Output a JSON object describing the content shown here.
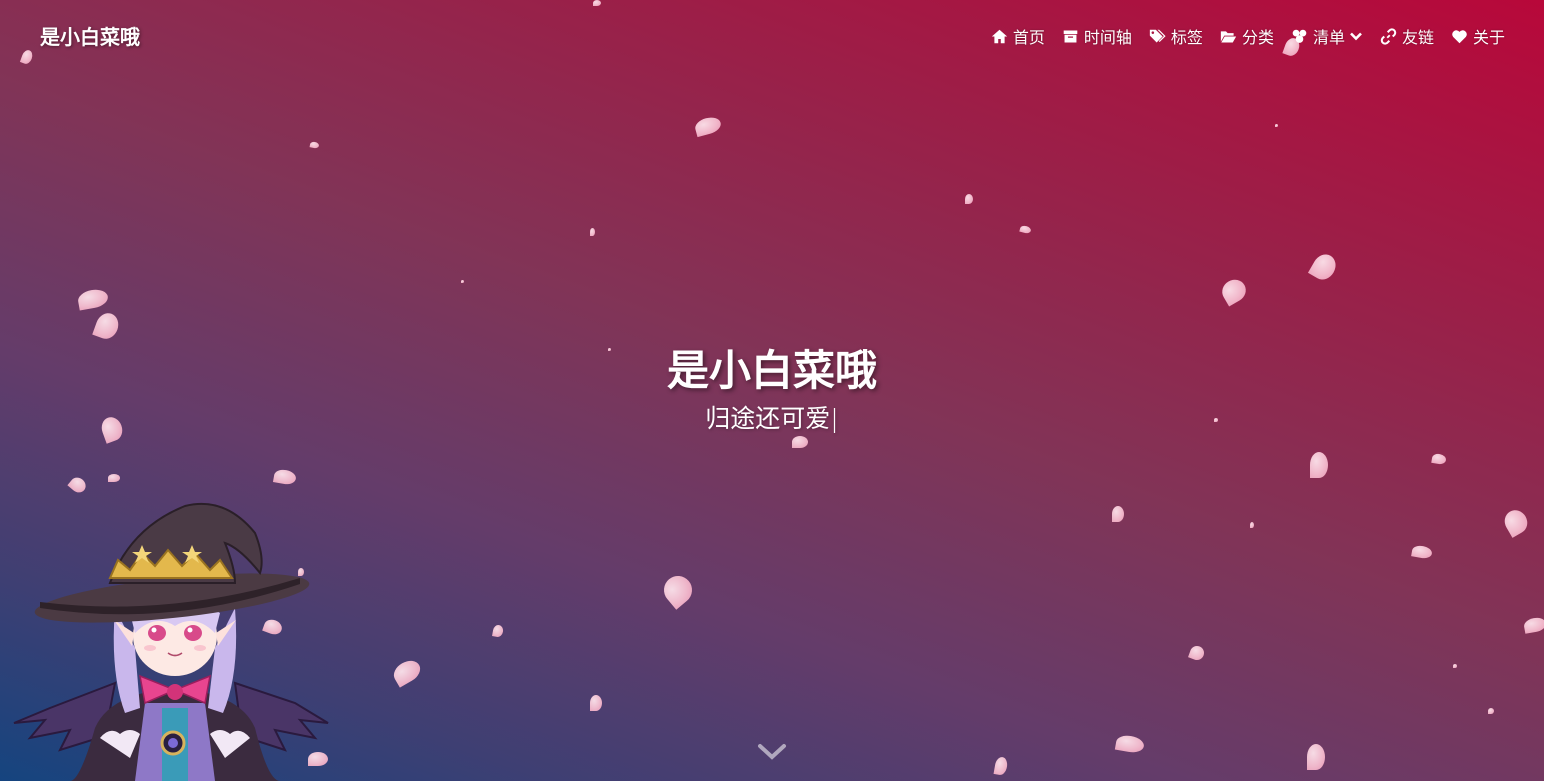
{
  "header": {
    "brand": "是小白菜哦",
    "nav": [
      {
        "label": "首页",
        "icon": "home-icon"
      },
      {
        "label": "时间轴",
        "icon": "archive-icon"
      },
      {
        "label": "标签",
        "icon": "tags-icon"
      },
      {
        "label": "分类",
        "icon": "folder-open-icon"
      },
      {
        "label": "清单",
        "icon": "list-icon",
        "dropdown": true
      },
      {
        "label": "友链",
        "icon": "link-icon"
      },
      {
        "label": "关于",
        "icon": "heart-icon"
      }
    ]
  },
  "hero": {
    "title": "是小白菜哦",
    "subtitle": "归途还可爱",
    "cursor": "|"
  },
  "colors": {
    "gradient_top_right": "#b8083a",
    "gradient_bottom_left": "#15447f",
    "petal": "#f6bfd1"
  }
}
